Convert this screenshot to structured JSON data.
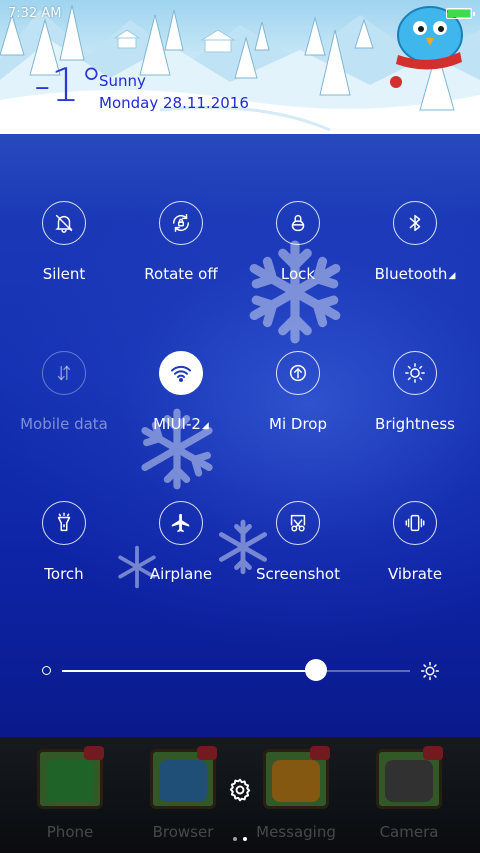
{
  "status_bar": {
    "time": "7:32 AM",
    "battery_level": 1.0
  },
  "weather": {
    "temperature": "-1°",
    "condition": "Sunny",
    "date": "Monday 28.11.2016"
  },
  "toggles": [
    {
      "label": "Silent",
      "icon": "bell-off-icon",
      "state": "off",
      "has_caret": false
    },
    {
      "label": "Rotate off",
      "icon": "rotate-lock-icon",
      "state": "off",
      "has_caret": false
    },
    {
      "label": "Lock",
      "icon": "lock-icon",
      "state": "off",
      "has_caret": false
    },
    {
      "label": "Bluetooth",
      "icon": "bluetooth-icon",
      "state": "off",
      "has_caret": true
    },
    {
      "label": "Mobile data",
      "icon": "mobile-data-icon",
      "state": "disabled",
      "has_caret": false
    },
    {
      "label": "MIUI-2",
      "icon": "wifi-icon",
      "state": "on",
      "has_caret": true
    },
    {
      "label": "Mi Drop",
      "icon": "mi-drop-icon",
      "state": "off",
      "has_caret": false
    },
    {
      "label": "Brightness",
      "icon": "sun-icon",
      "state": "off",
      "has_caret": false
    },
    {
      "label": "Torch",
      "icon": "flashlight-icon",
      "state": "off",
      "has_caret": false
    },
    {
      "label": "Airplane",
      "icon": "airplane-icon",
      "state": "off",
      "has_caret": false
    },
    {
      "label": "Screenshot",
      "icon": "scissors-icon",
      "state": "off",
      "has_caret": false
    },
    {
      "label": "Vibrate",
      "icon": "vibrate-icon",
      "state": "off",
      "has_caret": false
    }
  ],
  "brightness": {
    "level": 0.73
  },
  "dock": {
    "apps": [
      {
        "name": "Phone",
        "icon": "phone-icon",
        "inner_color": "#39b44a"
      },
      {
        "name": "Browser",
        "icon": "browser-icon",
        "inner_color": "#3a8fd8"
      },
      {
        "name": "Messaging",
        "icon": "messaging-icon",
        "inner_color": "#f0a020"
      },
      {
        "name": "Camera",
        "icon": "camera-icon",
        "inner_color": "#5a5a5a"
      }
    ],
    "current_page": 2,
    "page_count": 2
  },
  "colors": {
    "panel_top": "#1d3bb8",
    "panel_bottom": "#0a1a8c",
    "weather_text": "#1d2bd8",
    "toggle_on_bg": "#ffffff"
  }
}
